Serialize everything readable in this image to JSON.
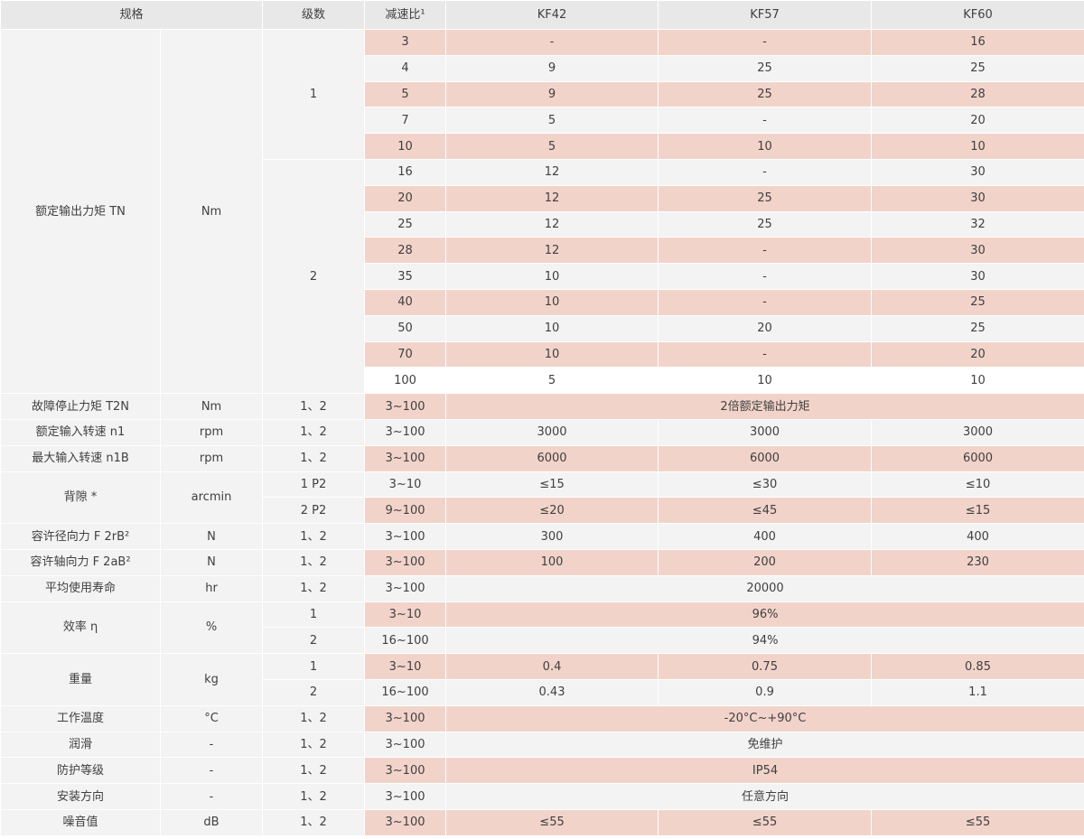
{
  "header": {
    "spec": "规格",
    "stage": "级数",
    "ratio": "减速比¹",
    "kf42": "KF42",
    "kf57": "KF57",
    "kf60": "KF60"
  },
  "rated_torque": {
    "label": "额定输出力矩 TN",
    "unit": "Nm",
    "stage1": "1",
    "stage2": "2",
    "rows": [
      {
        "ratio": "3",
        "kf42": "-",
        "kf57": "-",
        "kf60": "16"
      },
      {
        "ratio": "4",
        "kf42": "9",
        "kf57": "25",
        "kf60": "25"
      },
      {
        "ratio": "5",
        "kf42": "9",
        "kf57": "25",
        "kf60": "28"
      },
      {
        "ratio": "7",
        "kf42": "5",
        "kf57": "-",
        "kf60": "20"
      },
      {
        "ratio": "10",
        "kf42": "5",
        "kf57": "10",
        "kf60": "10"
      },
      {
        "ratio": "16",
        "kf42": "12",
        "kf57": "-",
        "kf60": "30"
      },
      {
        "ratio": "20",
        "kf42": "12",
        "kf57": "25",
        "kf60": "30"
      },
      {
        "ratio": "25",
        "kf42": "12",
        "kf57": "25",
        "kf60": "32"
      },
      {
        "ratio": "28",
        "kf42": "12",
        "kf57": "-",
        "kf60": "30"
      },
      {
        "ratio": "35",
        "kf42": "10",
        "kf57": "-",
        "kf60": "30"
      },
      {
        "ratio": "40",
        "kf42": "10",
        "kf57": "-",
        "kf60": "25"
      },
      {
        "ratio": "50",
        "kf42": "10",
        "kf57": "20",
        "kf60": "25"
      },
      {
        "ratio": "70",
        "kf42": "10",
        "kf57": "-",
        "kf60": "20"
      },
      {
        "ratio": "100",
        "kf42": "5",
        "kf57": "10",
        "kf60": "10"
      }
    ]
  },
  "emergency_stop": {
    "label": "故障停止力矩 T2N",
    "unit": "Nm",
    "stage": "1、2",
    "ratio": "3~100",
    "value": "2倍额定输出力矩"
  },
  "rated_input_speed": {
    "label": "额定输入转速 n1",
    "unit": "rpm",
    "stage": "1、2",
    "ratio": "3~100",
    "kf42": "3000",
    "kf57": "3000",
    "kf60": "3000"
  },
  "max_input_speed": {
    "label": "最大输入转速 n1B",
    "unit": "rpm",
    "stage": "1、2",
    "ratio": "3~100",
    "kf42": "6000",
    "kf57": "6000",
    "kf60": "6000"
  },
  "backlash": {
    "label": "背隙 *",
    "unit": "arcmin",
    "rows": [
      {
        "stage": "1 P2",
        "ratio": "3~10",
        "kf42": "≤15",
        "kf57": "≤30",
        "kf60": "≤10"
      },
      {
        "stage": "2 P2",
        "ratio": "9~100",
        "kf42": "≤20",
        "kf57": "≤45",
        "kf60": "≤15"
      }
    ]
  },
  "radial_force": {
    "label": "容许径向力 F 2rB²",
    "unit": "N",
    "stage": "1、2",
    "ratio": "3~100",
    "kf42": "300",
    "kf57": "400",
    "kf60": "400"
  },
  "axial_force": {
    "label": "容许轴向力 F 2aB²",
    "unit": "N",
    "stage": "1、2",
    "ratio": "3~100",
    "kf42": "100",
    "kf57": "200",
    "kf60": "230"
  },
  "service_life": {
    "label": "平均使用寿命",
    "unit": "hr",
    "stage": "1、2",
    "ratio": "3~100",
    "value": "20000"
  },
  "efficiency": {
    "label": "效率 η",
    "unit": "%",
    "rows": [
      {
        "stage": "1",
        "ratio": "3~10",
        "value": "96%"
      },
      {
        "stage": "2",
        "ratio": "16~100",
        "value": "94%"
      }
    ]
  },
  "weight": {
    "label": "重量",
    "unit": "kg",
    "rows": [
      {
        "stage": "1",
        "ratio": "3~10",
        "kf42": "0.4",
        "kf57": "0.75",
        "kf60": "0.85"
      },
      {
        "stage": "2",
        "ratio": "16~100",
        "kf42": "0.43",
        "kf57": "0.9",
        "kf60": "1.1"
      }
    ]
  },
  "temperature": {
    "label": "工作温度",
    "unit": "°C",
    "stage": "1、2",
    "ratio": "3~100",
    "value": "-20°C~+90°C"
  },
  "lubrication": {
    "label": "润滑",
    "unit": "-",
    "stage": "1、2",
    "ratio": "3~100",
    "value": "免维护"
  },
  "protection": {
    "label": "防护等级",
    "unit": "-",
    "stage": "1、2",
    "ratio": "3~100",
    "value": "IP54"
  },
  "mounting": {
    "label": "安装方向",
    "unit": "-",
    "stage": "1、2",
    "ratio": "3~100",
    "value": "任意方向"
  },
  "noise": {
    "label": "噪音值",
    "unit": "dB",
    "stage": "1、2",
    "ratio": "3~100",
    "kf42": "≤55",
    "kf57": "≤55",
    "kf60": "≤55"
  }
}
